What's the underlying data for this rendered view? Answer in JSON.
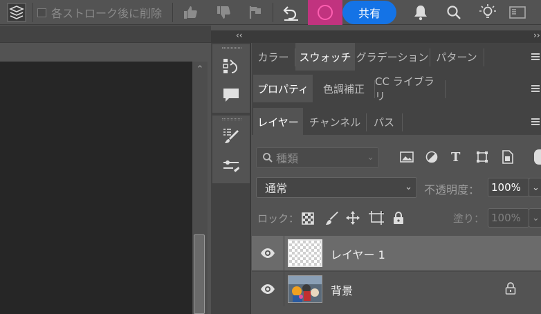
{
  "toolbar": {
    "checkbox_label": "各ストローク後に削除",
    "share_label": "共有",
    "icons": [
      "layers-stack-icon",
      "thumbs-up-icon",
      "thumbs-down-icon",
      "flag-icon",
      "undo-icon",
      "circle-icon",
      "bell-icon",
      "search-icon",
      "lightbulb-icon",
      "workspace-icon"
    ]
  },
  "dock": {
    "collapse_left": "‹‹",
    "collapse_right": "››"
  },
  "panel_groups": [
    {
      "tabs": [
        "カラー",
        "スウォッチ",
        "グラデーション",
        "パターン"
      ],
      "active": 1
    },
    {
      "tabs": [
        "プロパティ",
        "色調補正",
        "CC ライブラリ"
      ],
      "active": 0
    },
    {
      "tabs": [
        "レイヤー",
        "チャンネル",
        "パス"
      ],
      "active": 0
    }
  ],
  "layers_panel": {
    "filter_placeholder": "種類",
    "blend_mode": "通常",
    "opacity_label": "不透明度：",
    "opacity_value": "100%",
    "lock_label": "ロック：",
    "fill_label": "塗り：",
    "fill_value": "100%",
    "layers": [
      {
        "name": "レイヤー 1",
        "selected": true,
        "visible": true,
        "locked": false
      },
      {
        "name": "背景",
        "selected": false,
        "visible": true,
        "locked": true
      }
    ]
  },
  "colors": {
    "accent": "#1473e6",
    "active_tool": "#c1337f"
  }
}
